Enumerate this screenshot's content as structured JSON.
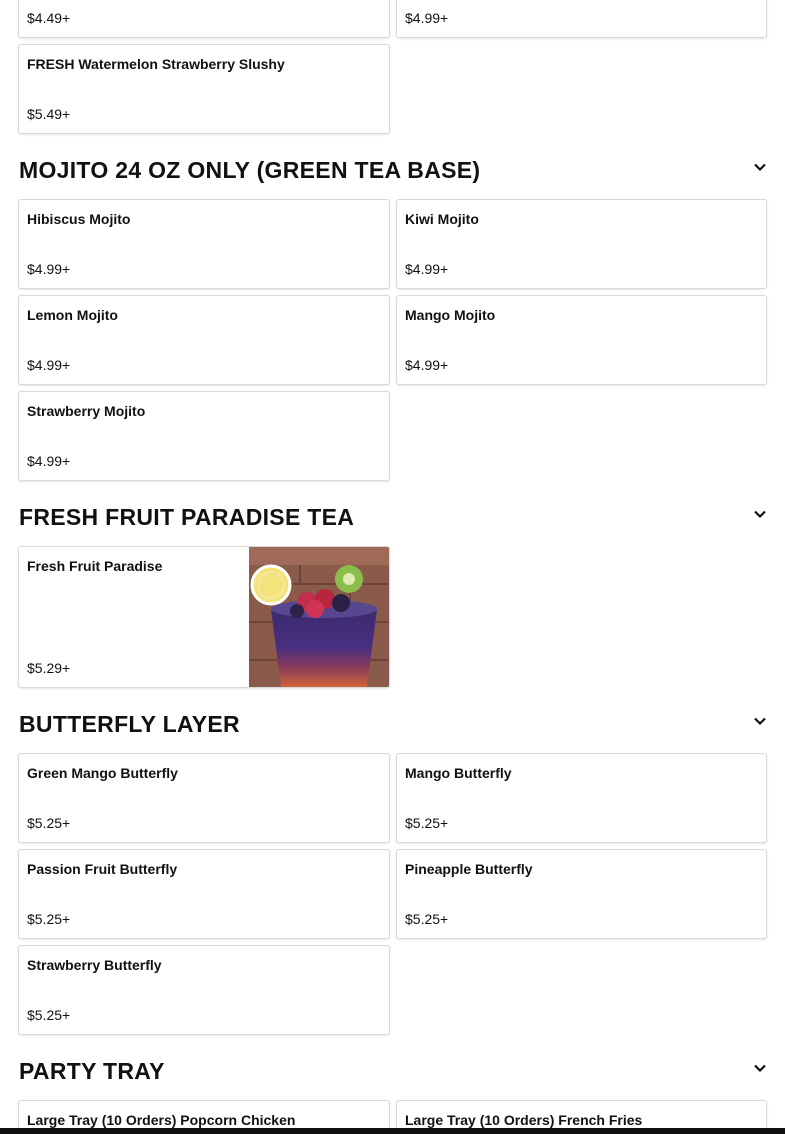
{
  "top_cards": [
    {
      "name": "",
      "price": "$4.49+"
    },
    {
      "name": "",
      "price": "$4.99+"
    },
    {
      "name": "FRESH Watermelon Strawberry Slushy       ",
      "price": "$5.49+"
    }
  ],
  "sections": [
    {
      "title": "MOJITO 24 OZ ONLY (GREEN TEA BASE)",
      "items": [
        {
          "name": "Hibiscus Mojito       ",
          "price": "$4.99+"
        },
        {
          "name": "Kiwi Mojito       ",
          "price": "$4.99+"
        },
        {
          "name": "Lemon Mojito      ",
          "price": "$4.99+"
        },
        {
          "name": "Mango Mojito      ",
          "price": "$4.99+"
        },
        {
          "name": "Strawberry Mojito      ",
          "price": "$4.99+"
        }
      ]
    },
    {
      "title": "FRESH FRUIT PARADISE TEA      ",
      "items": [
        {
          "name": "Fresh Fruit Paradise       ",
          "price": "$5.29+",
          "image": "fruit-tea-photo"
        }
      ]
    },
    {
      "title": "BUTTERFLY LAYER",
      "items": [
        {
          "name": "Green Mango Butterfly",
          "price": "$5.25+"
        },
        {
          "name": "Mango Butterfly",
          "price": "$5.25+"
        },
        {
          "name": "Passion Fruit Butterfly",
          "price": "$5.25+"
        },
        {
          "name": "Pineapple Butterfly",
          "price": "$5.25+"
        },
        {
          "name": "Strawberry Butterfly",
          "price": "$5.25+"
        }
      ]
    },
    {
      "title": "PARTY TRAY    ",
      "items": [
        {
          "name": "Large Tray (10 Orders) Popcorn Chicken    ",
          "price": ""
        },
        {
          "name": "Large Tray (10 Orders) French Fries   ",
          "price": ""
        }
      ]
    }
  ],
  "icons": {
    "section_toggle": "chevron-down-icon"
  }
}
